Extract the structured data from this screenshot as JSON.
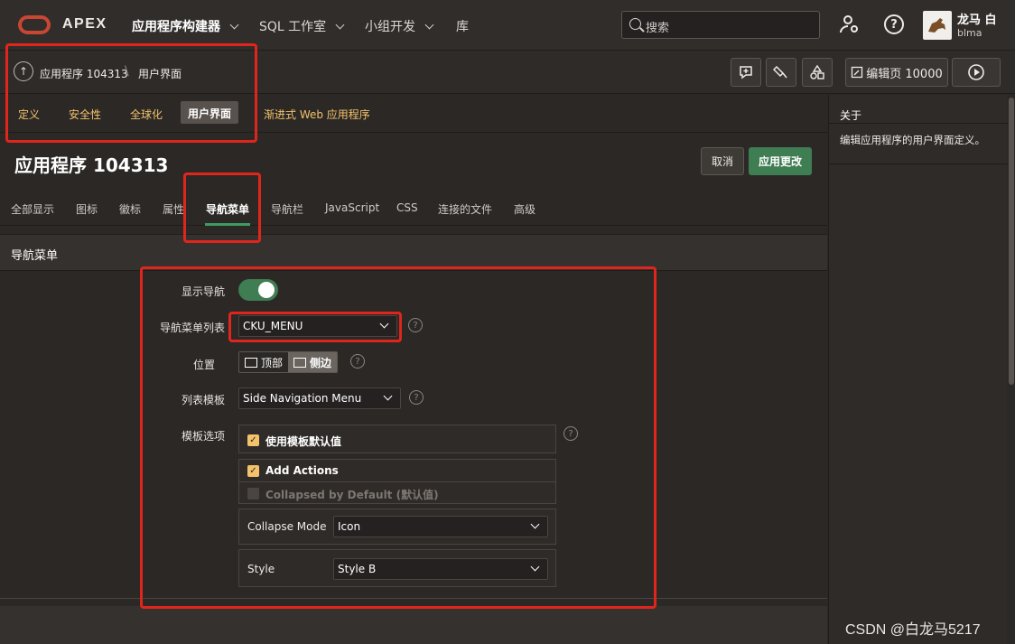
{
  "brand": {
    "name": "APEX"
  },
  "topnav": [
    {
      "label": "应用程序构建器",
      "bold": true
    },
    {
      "label": "SQL 工作室",
      "bold": false
    },
    {
      "label": "小组开发",
      "bold": false
    },
    {
      "label": "库",
      "bold": false
    }
  ],
  "search": {
    "placeholder": "搜索"
  },
  "user": {
    "name": "龙马 白",
    "login": "blma"
  },
  "breadcrumb": {
    "app": "应用程序 104313",
    "page": "用户界面"
  },
  "toolbar": {
    "edit_page_label": "编辑页 10000"
  },
  "subtabs": [
    "定义",
    "安全性",
    "全球化",
    "用户界面",
    "渐进式 Web 应用程序"
  ],
  "page_title": "应用程序 104313",
  "buttons": {
    "cancel": "取消",
    "apply": "应用更改"
  },
  "tabs": [
    "全部显示",
    "图标",
    "徽标",
    "属性",
    "导航菜单",
    "导航栏",
    "JavaScript",
    "CSS",
    "连接的文件",
    "高级"
  ],
  "section_title": "导航菜单",
  "form": {
    "show_nav_label": "显示导航",
    "nav_list_label": "导航菜单列表",
    "nav_list_value": "CKU_MENU",
    "position_label": "位置",
    "position_top": "顶部",
    "position_side": "侧边",
    "list_template_label": "列表模板",
    "list_template_value": "Side Navigation Menu",
    "template_options_label": "模板选项",
    "use_defaults": "使用模板默认值",
    "add_actions": "Add Actions",
    "collapsed_default": "Collapsed by Default (默认值)",
    "collapse_mode_label": "Collapse Mode",
    "collapse_mode_value": "Icon",
    "style_label": "Style",
    "style_value": "Style B",
    "help_mark": "?"
  },
  "right_panel": {
    "title": "关于",
    "description": "编辑应用程序的用户界面定义。"
  },
  "watermark": "CSDN @白龙马5217",
  "colors": {
    "accent_green": "#3f7d52",
    "tab_yellow": "#f3c26b",
    "annotation_red": "#e0261c",
    "background": "#2b2826"
  }
}
